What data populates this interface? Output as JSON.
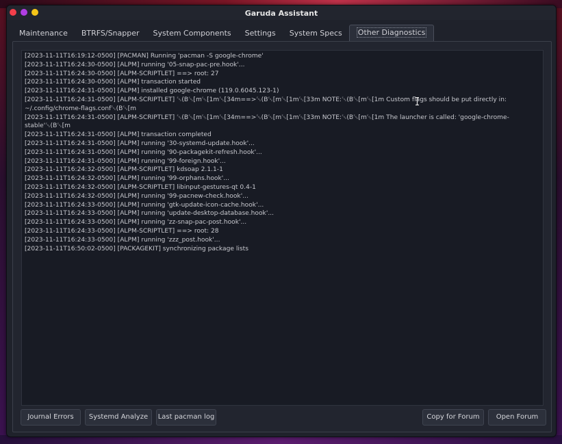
{
  "window": {
    "title": "Garuda Assistant"
  },
  "tabs": [
    {
      "label": "Maintenance",
      "active": false
    },
    {
      "label": "BTRFS/Snapper",
      "active": false
    },
    {
      "label": "System Components",
      "active": false
    },
    {
      "label": "Settings",
      "active": false
    },
    {
      "label": "System Specs",
      "active": false
    },
    {
      "label": "Other Diagnostics",
      "active": true
    }
  ],
  "log": {
    "lines": [
      "[2023-11-11T16:19:12-0500] [PACMAN] Running 'pacman -S google-chrome'",
      "[2023-11-11T16:24:30-0500] [ALPM] running '05-snap-pac-pre.hook'...",
      "[2023-11-11T16:24:30-0500] [ALPM-SCRIPTLET] ==> root: 27",
      "[2023-11-11T16:24:30-0500] [ALPM] transaction started",
      "[2023-11-11T16:24:31-0500] [ALPM] installed google-chrome (119.0.6045.123-1)",
      "[2023-11-11T16:24:31-0500] [ALPM-SCRIPTLET] ␛(B␛[m␛[1m␛[34m==>␛(B␛[m␛[1m␛[33m NOTE:␛(B␛[m␛[1m Custom flags should be put directly in: ~/.config/chrome-flags.conf␛(B␛[m",
      "[2023-11-11T16:24:31-0500] [ALPM-SCRIPTLET] ␛(B␛[m␛[1m␛[34m==>␛(B␛[m␛[1m␛[33m NOTE:␛(B␛[m␛[1m The launcher is called: 'google-chrome-stable'␛(B␛[m",
      "[2023-11-11T16:24:31-0500] [ALPM] transaction completed",
      "[2023-11-11T16:24:31-0500] [ALPM] running '30-systemd-update.hook'...",
      "[2023-11-11T16:24:31-0500] [ALPM] running '90-packagekit-refresh.hook'...",
      "[2023-11-11T16:24:31-0500] [ALPM] running '99-foreign.hook'...",
      "[2023-11-11T16:24:32-0500] [ALPM-SCRIPTLET] kdsoap 2.1.1-1",
      "[2023-11-11T16:24:32-0500] [ALPM] running '99-orphans.hook'...",
      "[2023-11-11T16:24:32-0500] [ALPM-SCRIPTLET] libinput-gestures-qt 0.4-1",
      "[2023-11-11T16:24:32-0500] [ALPM] running '99-pacnew-check.hook'...",
      "[2023-11-11T16:24:33-0500] [ALPM] running 'gtk-update-icon-cache.hook'...",
      "[2023-11-11T16:24:33-0500] [ALPM] running 'update-desktop-database.hook'...",
      "[2023-11-11T16:24:33-0500] [ALPM] running 'zz-snap-pac-post.hook'...",
      "[2023-11-11T16:24:33-0500] [ALPM-SCRIPTLET] ==> root: 28",
      "[2023-11-11T16:24:33-0500] [ALPM] running 'zzz_post.hook'...",
      "[2023-11-11T16:50:02-0500] [PACKAGEKIT] synchronizing package lists"
    ]
  },
  "buttons": {
    "journal_errors": "Journal Errors",
    "systemd_analyze": "Systemd Analyze",
    "last_pacman_log": "Last pacman log",
    "copy_for_forum": "Copy for Forum",
    "open_forum": "Open Forum"
  },
  "colors": {
    "close": "#f43f4b",
    "minimize": "#b13ee3",
    "maximize": "#f5c518",
    "window_bg": "#1f222b",
    "log_bg": "#181b24",
    "text": "#c8c9cf"
  }
}
